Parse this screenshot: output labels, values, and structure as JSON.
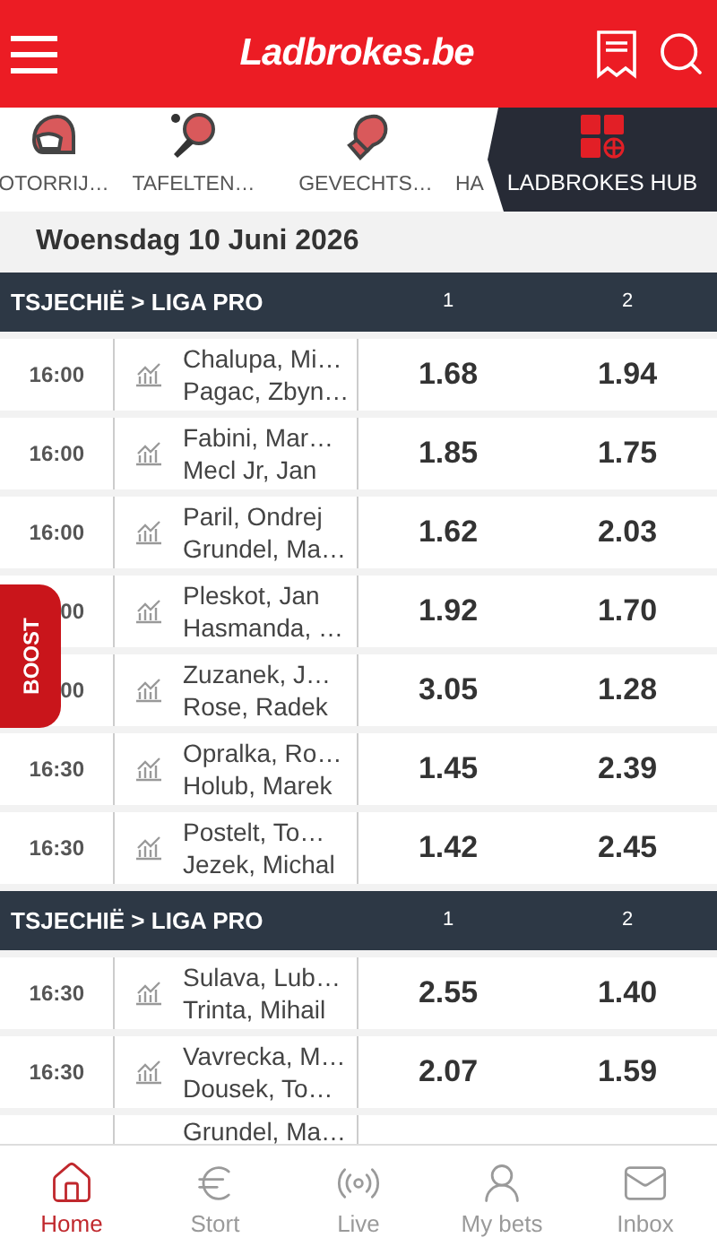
{
  "header": {
    "logo": "Ladbrokes.be"
  },
  "sports": [
    {
      "label": "OTORRIJ…",
      "kind": "helmet"
    },
    {
      "label": "TAFELTEN…",
      "kind": "paddle"
    },
    {
      "label": "GEVECHTS…",
      "kind": "glove"
    },
    {
      "label": "HA",
      "kind": "none"
    }
  ],
  "hub": {
    "label": "LADBROKES HUB"
  },
  "date": "Woensdag 10 Juni 2026",
  "sections": [
    {
      "league": "TSJECHIË > LIGA PRO",
      "columns": [
        "1",
        "2"
      ],
      "events": [
        {
          "time": "16:00",
          "home": "Chalupa, Mi…",
          "away": "Pagac, Zbyn…",
          "odds": [
            "1.68",
            "1.94"
          ]
        },
        {
          "time": "16:00",
          "home": "Fabini, Mar…",
          "away": "Mecl Jr, Jan",
          "odds": [
            "1.85",
            "1.75"
          ]
        },
        {
          "time": "16:00",
          "home": "Paril, Ondrej",
          "away": "Grundel, Ma…",
          "odds": [
            "1.62",
            "2.03"
          ]
        },
        {
          "time": "00",
          "home": "Pleskot, Jan",
          "away": "Hasmanda, …",
          "odds": [
            "1.92",
            "1.70"
          ]
        },
        {
          "time": "00",
          "home": "Zuzanek, J…",
          "away": "Rose, Radek",
          "odds": [
            "3.05",
            "1.28"
          ]
        },
        {
          "time": "16:30",
          "home": "Opralka, Ro…",
          "away": "Holub, Marek",
          "odds": [
            "1.45",
            "2.39"
          ]
        },
        {
          "time": "16:30",
          "home": "Postelt, To…",
          "away": "Jezek, Michal",
          "odds": [
            "1.42",
            "2.45"
          ]
        }
      ]
    },
    {
      "league": "TSJECHIË > LIGA PRO",
      "columns": [
        "1",
        "2"
      ],
      "events": [
        {
          "time": "16:30",
          "home": "Sulava, Lub…",
          "away": "Trinta, Mihail",
          "odds": [
            "2.55",
            "1.40"
          ]
        },
        {
          "time": "16:30",
          "home": "Vavrecka, M…",
          "away": "Dousek, To…",
          "odds": [
            "2.07",
            "1.59"
          ]
        },
        {
          "home": "Grundel, Ma…"
        }
      ]
    }
  ],
  "boost": {
    "label": "BOOST"
  },
  "nav": [
    {
      "label": "Home",
      "kind": "home",
      "selected": true
    },
    {
      "label": "Stort",
      "kind": "deposit",
      "selected": false
    },
    {
      "label": "Live",
      "kind": "live",
      "selected": false
    },
    {
      "label": "My bets",
      "kind": "bets",
      "selected": false
    },
    {
      "label": "Inbox",
      "kind": "inbox",
      "selected": false
    }
  ]
}
